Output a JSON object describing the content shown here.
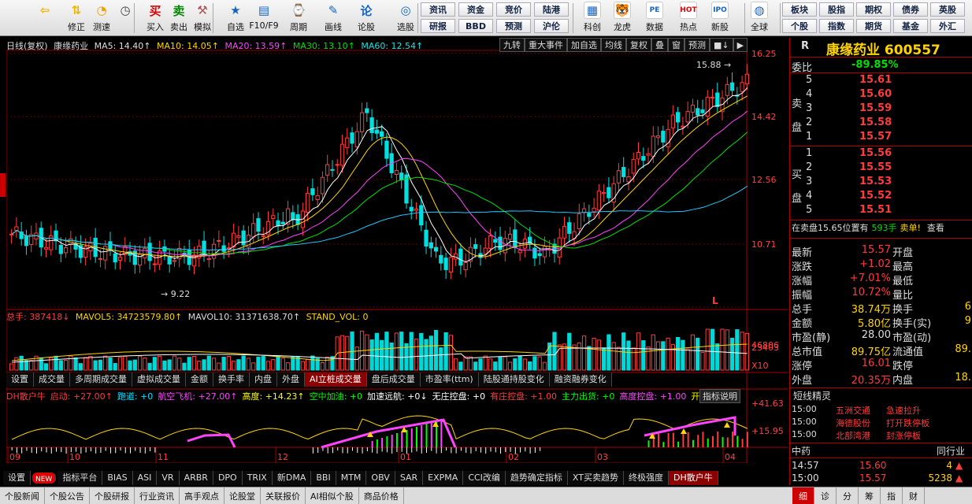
{
  "toolbar": {
    "buttons": [
      {
        "label": "",
        "icon": "back-arrow-icon"
      },
      {
        "label": "修正",
        "icon": "up-down-arrows-icon"
      },
      {
        "label": "测速",
        "icon": "speed-icon"
      },
      {
        "label": "",
        "icon": "clock-icon"
      },
      {
        "label": "买入",
        "icon": "buy-icon",
        "glyph": "买"
      },
      {
        "label": "卖出",
        "icon": "sell-icon",
        "glyph": "卖"
      },
      {
        "label": "模拟",
        "icon": "hammer-icon"
      },
      {
        "label": "自选",
        "icon": "star-icon"
      },
      {
        "label": "F10/F9",
        "icon": "f10-icon"
      },
      {
        "label": "周期",
        "icon": "period-icon"
      },
      {
        "label": "画线",
        "icon": "pencil-icon"
      },
      {
        "label": "论股",
        "icon": "discuss-icon"
      },
      {
        "label": "选股",
        "icon": "select-stock-icon"
      }
    ],
    "grid": [
      [
        "资讯",
        "资金",
        "竞价",
        "陆港"
      ],
      [
        "研报",
        "BBD",
        "预测",
        "沪伦"
      ]
    ],
    "right_buttons": [
      {
        "label": "科创",
        "icon": "chart-icon"
      },
      {
        "label": "龙虎",
        "icon": "tiger-icon"
      },
      {
        "label": "数据",
        "icon": "pe-icon",
        "glyph": "PE"
      },
      {
        "label": "热点",
        "icon": "hot-icon",
        "glyph": "HOT"
      },
      {
        "label": "新股",
        "icon": "ipo-icon",
        "glyph": "IPO"
      },
      {
        "label": "全球",
        "icon": "globe-icon"
      }
    ],
    "grid2": [
      [
        "板块",
        "股指",
        "期权",
        "债券",
        "英股"
      ],
      [
        "个股",
        "指数",
        "期货",
        "基金",
        "外汇"
      ]
    ]
  },
  "chart_header": {
    "period": "日线(复权)",
    "name": "康缘药业",
    "ma5": "MA5: 14.40↑",
    "ma10": "MA10: 14.05↑",
    "ma20": "MA20: 13.59↑",
    "ma30": "MA30: 13.10↑",
    "ma60": "MA60: 12.54↑"
  },
  "chart_tools": [
    "九转",
    "重大事件",
    "加自选",
    "均线",
    "复权",
    "叠",
    "窗",
    "预测",
    "■↓",
    "▶"
  ],
  "y_axis": [
    "16.25",
    "14.42",
    "12.56",
    "10.71"
  ],
  "price_marks": {
    "high": "15.88",
    "low": "9.22",
    "flag": "L"
  },
  "volume_header": {
    "total": "总手: 387418↓",
    "mavol5": "MAVOL5: 34723579.80↑",
    "mavol10": "MAVOL10: 31371638.70↑",
    "stand": "STAND_VOL: 0"
  },
  "volume_axis": [
    "46806",
    "23403",
    "X10"
  ],
  "indicator_tabs": [
    "设置",
    "成交量",
    "多周期成交量",
    "虚拟成交量",
    "金额",
    "换手率",
    "内盘",
    "外盘",
    "AI立桩成交量",
    "盘后成交量",
    "市盈率(ttm)",
    "陆股通持股变化",
    "融资融券变化"
  ],
  "indicator_active": "AI立桩成交量",
  "dh_header": [
    {
      "t": "DH散户牛",
      "c": "#ff3b3b"
    },
    {
      "t": "启动: +27.00↑",
      "c": "#ff3b3b"
    },
    {
      "t": "跑道: +0",
      "c": "#00e0ff"
    },
    {
      "t": "航空飞机: +27.00↑",
      "c": "#ff44ff"
    },
    {
      "t": "高度: +14.23↑",
      "c": "#ffff00"
    },
    {
      "t": "空中加油: +0",
      "c": "#00ff00"
    },
    {
      "t": "加速远航: +0↓",
      "c": "#ffffff"
    },
    {
      "t": "无庄控盘: +0",
      "c": "#ffffff"
    },
    {
      "t": "有庄控盘: +1.00",
      "c": "#ff3b3b"
    },
    {
      "t": "主力出货: +0",
      "c": "#00ff00"
    },
    {
      "t": "高度控盘: +1.00",
      "c": "#ff44ff"
    },
    {
      "t": "开始控盘",
      "c": "#ffff00"
    }
  ],
  "indicator_help": "指标说明",
  "dh_axis": [
    "+41.63",
    "+15.95"
  ],
  "x_axis": [
    "09",
    "10",
    "11",
    "12",
    "01",
    "02",
    "03",
    "04"
  ],
  "bottom_tabs": [
    "设置",
    "NEW",
    "指标平台",
    "BIAS",
    "ASI",
    "VR",
    "ARBR",
    "DPO",
    "TRIX",
    "新DMA",
    "BBI",
    "MTM",
    "OBV",
    "SAR",
    "EXPMA",
    "CCI改编",
    "趋势确定指标",
    "XT买卖趋势",
    "终极强度",
    "DH散户牛"
  ],
  "bottom_active": "DH散户牛",
  "footer": [
    "个股新闻",
    "个股公告",
    "个股研报",
    "行业资讯",
    "高手观点",
    "论股堂",
    "关联报价",
    "AI相似个股",
    "商品价格"
  ],
  "footer_right": [
    "细",
    "诊",
    "分",
    "筹",
    "指",
    "财"
  ],
  "right_panel": {
    "title": "康缘药业 600557",
    "tag": "R",
    "weibi_label": "委比",
    "weibi": "-89.85%",
    "sell_label": "卖盘",
    "buy_label": "买盘",
    "sells": [
      {
        "n": "5",
        "p": "15.61"
      },
      {
        "n": "4",
        "p": "15.60"
      },
      {
        "n": "3",
        "p": "15.59"
      },
      {
        "n": "2",
        "p": "15.58"
      },
      {
        "n": "1",
        "p": "15.57"
      }
    ],
    "buys": [
      {
        "n": "1",
        "p": "15.56"
      },
      {
        "n": "2",
        "p": "15.55"
      },
      {
        "n": "3",
        "p": "15.53"
      },
      {
        "n": "4",
        "p": "15.52"
      },
      {
        "n": "5",
        "p": "15.51"
      }
    ],
    "pending": "在卖盘15.65位置有",
    "pending_vol": "593手",
    "pending_tail": "卖单!",
    "pending_more": "查看",
    "stats": [
      {
        "l": "最新",
        "v": "15.57",
        "c": "red",
        "l2": "开盘",
        "v2": ""
      },
      {
        "l": "涨跌",
        "v": "+1.02",
        "c": "red",
        "l2": "最高",
        "v2": ""
      },
      {
        "l": "涨幅",
        "v": "+7.01%",
        "c": "red",
        "l2": "最低",
        "v2": ""
      },
      {
        "l": "振幅",
        "v": "10.72%",
        "c": "red",
        "l2": "量比",
        "v2": ""
      },
      {
        "l": "总手",
        "v": "38.74万",
        "c": "yellow",
        "l2": "换手",
        "v2": "6"
      },
      {
        "l": "金额",
        "v": "5.80亿",
        "c": "yellow",
        "l2": "换手(实)",
        "v2": "9"
      },
      {
        "l": "市盈(静)",
        "v": "28.00",
        "c": "white",
        "l2": "市盈(动)",
        "v2": ""
      },
      {
        "l": "总市值",
        "v": "89.75亿",
        "c": "yellow",
        "l2": "流通值",
        "v2": "89."
      },
      {
        "l": "涨停",
        "v": "16.01",
        "c": "red",
        "l2": "跌停",
        "v2": ""
      },
      {
        "l": "外盘",
        "v": "20.35万",
        "c": "red",
        "l2": "内盘",
        "v2": "18."
      }
    ],
    "news_title": "短线精灵",
    "news": [
      {
        "t": "15:00",
        "n": "五洲交通",
        "e": "急速拉升"
      },
      {
        "t": "15:00",
        "n": "海德股份",
        "e": "打开跌停板"
      },
      {
        "t": "15:00",
        "n": "北部湾港",
        "e": "封涨停板"
      }
    ],
    "sector_label": "中药",
    "sector_right": "同行业",
    "ticks": [
      {
        "t": "14:57",
        "p": "15.60",
        "v": "4"
      },
      {
        "t": "15:00",
        "p": "15.57",
        "v": "5238"
      }
    ]
  }
}
